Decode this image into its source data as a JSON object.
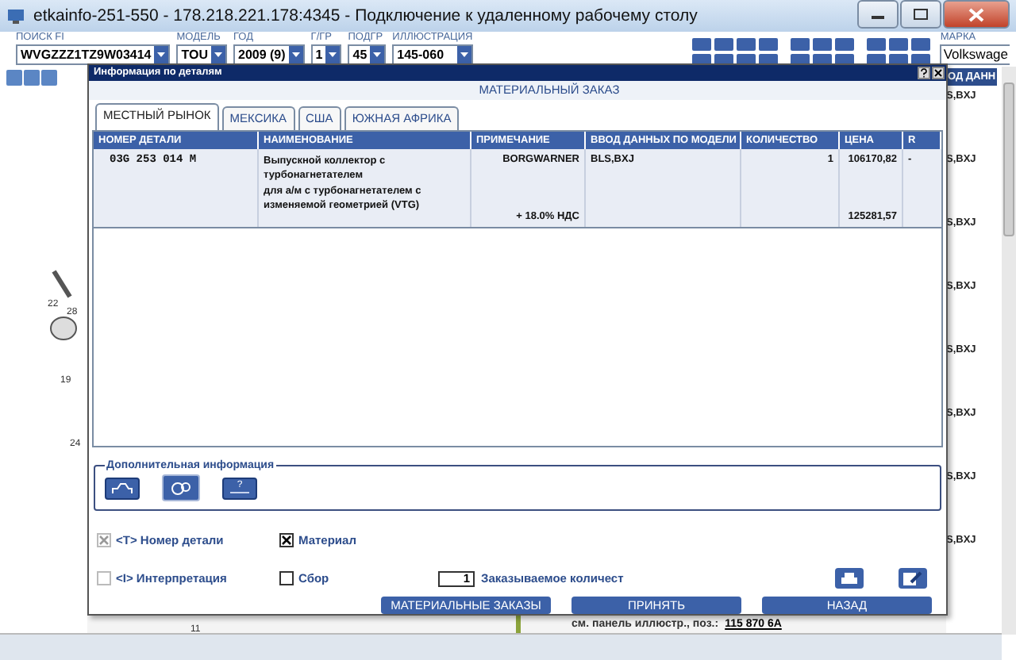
{
  "window": {
    "title": "etkainfo-251-550 - 178.218.221.178:4345 - Подключение к удаленному рабочему столу"
  },
  "search_fields": [
    {
      "label": "ПОИСК FI",
      "value": "WVGZZZ1TZ9W03414"
    },
    {
      "label": "МОДЕЛЬ",
      "value": "TOU"
    },
    {
      "label": "ГОД",
      "value": "2009 (9)"
    },
    {
      "label": "Г/ГР",
      "value": "1"
    },
    {
      "label": "ПОДГР",
      "value": "45"
    },
    {
      "label": "ИЛЛЮСТРАЦИЯ",
      "value": "145-060"
    }
  ],
  "brand": {
    "label": "МАРКА",
    "value": "Volkswage"
  },
  "diagram_labels": [
    "22",
    "28",
    "19",
    "24",
    "11"
  ],
  "right_column": {
    "header": "ОД ДАНН",
    "items": [
      "S,BXJ",
      "S,BXJ",
      "S,BXJ",
      "S,BXJ",
      "S,BXJ",
      "S,BXJ",
      "S,BXJ",
      "S,BXJ"
    ]
  },
  "footer": {
    "label": "см. панель иллюстр., поз.:",
    "link": "115 870 6А"
  },
  "dialog": {
    "title": "Информация по деталям",
    "heading": "МАТЕРИАЛЬНЫЙ ЗАКАЗ",
    "tabs": [
      {
        "label": "МЕСТНЫЙ РЫНОК",
        "selected": true
      },
      {
        "label": "МЕКСИКА",
        "selected": false
      },
      {
        "label": "США",
        "selected": false
      },
      {
        "label": "ЮЖНАЯ АФРИКА",
        "selected": false
      }
    ],
    "columns": [
      "НОМЕР ДЕТАЛИ",
      "НАИМЕНОВАНИЕ",
      "ПРИМЕЧАНИЕ",
      "ВВОД ДАННЫХ ПО МОДЕЛИ",
      "КОЛИЧЕСТВО",
      "ЦЕНА",
      "R"
    ],
    "rows": [
      {
        "part_number": "03G 253 014 M",
        "name": [
          "Выпускной коллектор с",
          "турбонагнетателем",
          "для а/м с турбонагнетателем с",
          "изменяемой геометрией (VTG)"
        ],
        "note": "BORGWARNER",
        "vat_note": "+ 18.0% НДС",
        "model_data": "BLS,BXJ",
        "quantity": "1",
        "price": "106170,82",
        "price_with_vat": "125281,57",
        "r": "-"
      }
    ],
    "extra_info": {
      "title": "Дополнительная информация",
      "buttons": [
        {
          "kind": "vehicle"
        },
        {
          "kind": "part"
        },
        {
          "kind": "help",
          "label": "?"
        }
      ]
    },
    "options": [
      {
        "label": "<T> Номер детали",
        "checked": true,
        "disabled": true
      },
      {
        "label": "Материал",
        "checked": true,
        "disabled": false
      },
      {
        "label": "<I> Интерпретация",
        "checked": false,
        "disabled": true
      },
      {
        "label": "Сбор",
        "checked": false,
        "disabled": false
      }
    ],
    "quantity": {
      "value": "1",
      "label": "Заказываемое количест"
    },
    "actions": [
      "МАТЕРИАЛЬНЫЕ ЗАКАЗЫ",
      "ПРИНЯТЬ",
      "НАЗАД"
    ]
  }
}
